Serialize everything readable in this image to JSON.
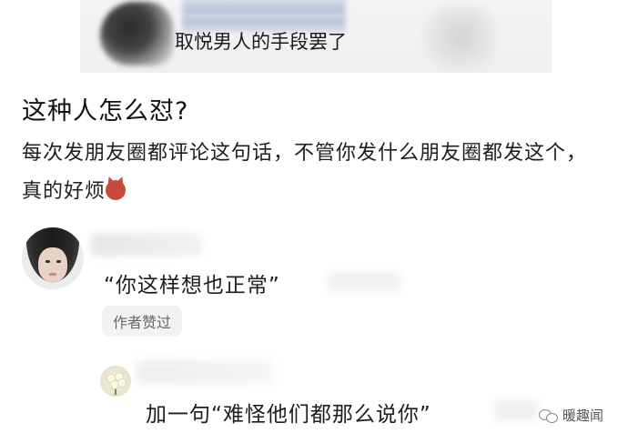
{
  "top_image": {
    "caption": "取悦男人的手段罢了"
  },
  "post": {
    "title": "这种人怎么怼?",
    "body": "每次发朋友圈都评论这句话，不管你发什么朋友圈都发这个，真的好烦",
    "emoji": "devil-face-icon"
  },
  "comments": [
    {
      "text": "“你这样想也正常”",
      "badge": "作者赞过"
    },
    {
      "text": "加一句“难怪他们都那么说你”"
    }
  ],
  "watermark": {
    "text": "暖趣闻",
    "icon": "wechat-icon"
  }
}
